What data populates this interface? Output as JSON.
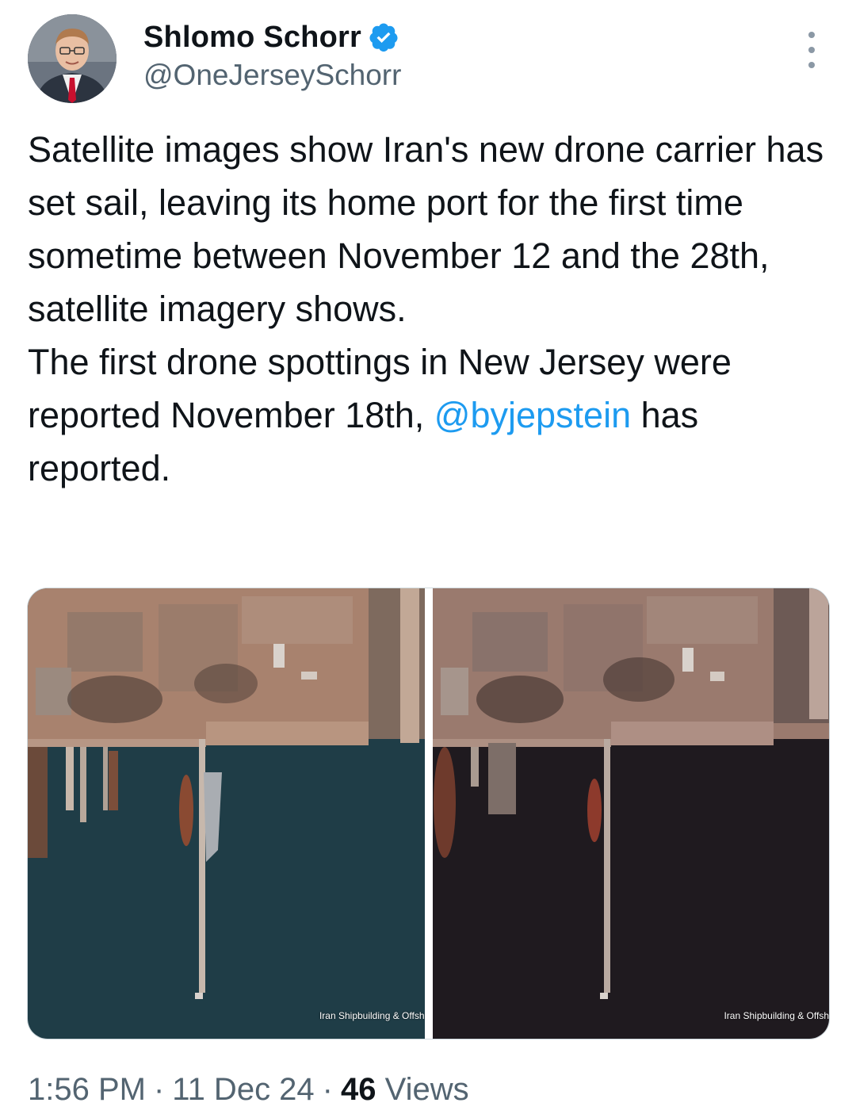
{
  "author": {
    "name": "Shlomo Schorr",
    "handle": "@OneJerseySchorr",
    "verified": true,
    "verified_color": "#1d9bf0"
  },
  "tweet": {
    "paragraph1": "Satellite images show Iran's new drone carrier has set sail, leaving its home port for the first time sometime between November 12 and the 28th, satellite imagery shows.",
    "paragraph2_before": "The first drone spottings in New Jersey were reported November 18th, ",
    "mention": "@byjepstein",
    "paragraph2_after": " has reported."
  },
  "media": {
    "images": [
      {
        "caption": "Iran Shipbuilding & Offsh"
      },
      {
        "caption": "Iran Shipbuilding & Offsh"
      }
    ]
  },
  "meta": {
    "time": "1:56 PM",
    "date": "11 Dec 24",
    "separator": "·",
    "views_count": "46",
    "views_label": "Views"
  },
  "icons": {
    "more": "more-vertical-icon",
    "verified": "verified-badge-icon"
  }
}
